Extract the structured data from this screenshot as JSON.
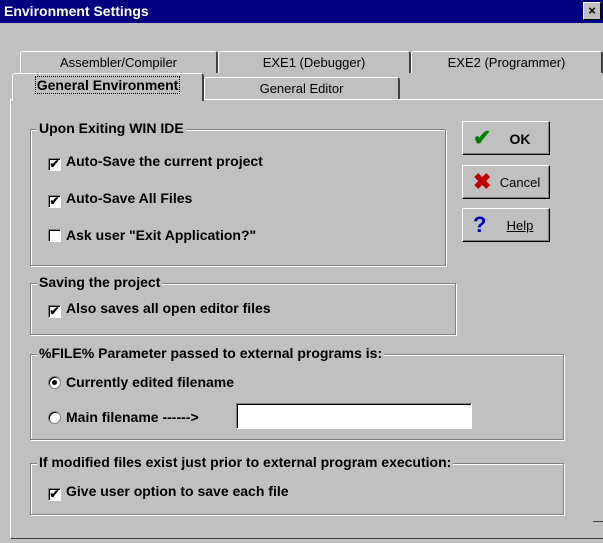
{
  "window": {
    "title": "Environment Settings",
    "close_glyph": "×"
  },
  "tabs": {
    "row1": [
      "Assembler/Compiler",
      "EXE1 (Debugger)",
      "EXE2 (Programmer)"
    ],
    "row2_active": "General Environment",
    "row2_other": "General Editor"
  },
  "exit_group": {
    "legend": "Upon Exiting WIN IDE",
    "options": [
      {
        "label": "Auto-Save the current project",
        "checked": true
      },
      {
        "label": "Auto-Save All Files",
        "checked": true
      },
      {
        "label": "Ask user \"Exit Application?\"",
        "checked": false
      }
    ]
  },
  "saving_group": {
    "legend": "Saving the project",
    "option": {
      "label": "Also saves all open editor files",
      "checked": true
    }
  },
  "file_param_group": {
    "legend": "%FILE% Parameter passed to external programs is:",
    "radio1": {
      "label": "Currently edited filename",
      "selected": true
    },
    "radio2": {
      "label": "Main filename ------>",
      "selected": false
    },
    "main_filename_value": ""
  },
  "modified_group": {
    "legend": "If modified files exist just prior to external program execution:",
    "option": {
      "label": "Give user option to save each file",
      "checked": true
    }
  },
  "buttons": {
    "ok": {
      "label": "OK",
      "icon": "check-icon",
      "color": "#008000"
    },
    "cancel": {
      "label": "Cancel",
      "icon": "x-icon",
      "color": "#c00000"
    },
    "help": {
      "label": "Help",
      "icon": "question-icon",
      "color": "#0000c0"
    }
  },
  "check_glyph": "✔"
}
